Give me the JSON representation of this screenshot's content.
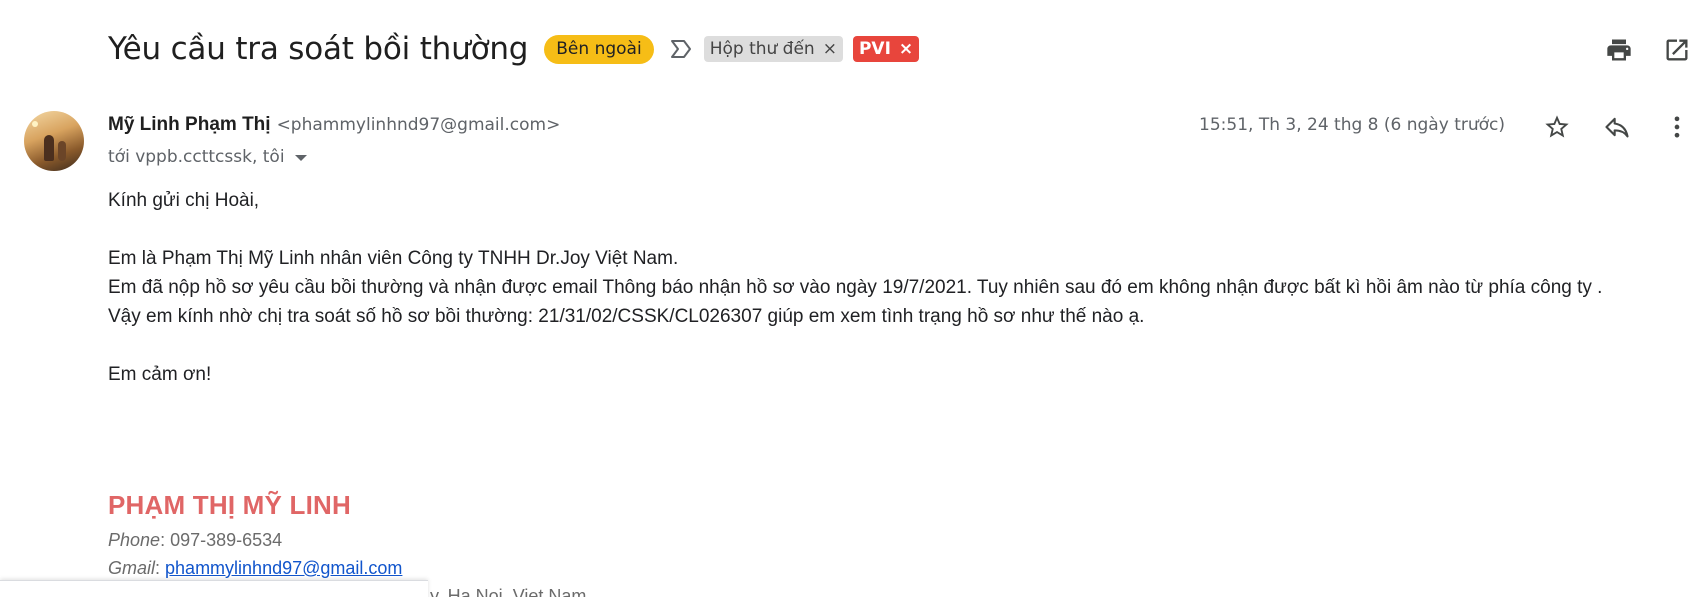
{
  "subject": "Yêu cầu tra soát bồi thường",
  "external_badge": "Bên ngoài",
  "labels": [
    {
      "name": "Hộp thư đến",
      "remove": "×"
    },
    {
      "name": "PVI",
      "remove": "×"
    }
  ],
  "colors": {
    "external_badge": "#f6bd16",
    "pvi_label": "#e8453c",
    "inbox_label": "#dddddd",
    "signature_name": "#e06666",
    "link": "#1155cc"
  },
  "icons": {
    "important": "important-marker-icon",
    "print": "print-icon",
    "new_window": "open-in-new-window-icon",
    "star": "star-icon",
    "reply": "reply-icon",
    "more": "more-vertical-icon"
  },
  "message": {
    "sender_name": "Mỹ Linh Phạm Thị",
    "sender_email": "<phammylinhnd97@gmail.com>",
    "recipients": "tới vppb.ccttcssk, tôi",
    "date": "15:51, Th 3, 24 thg 8 (6 ngày trước)",
    "body": [
      "Kính gửi chị Hoài,",
      "",
      "Em là Phạm Thị Mỹ Linh nhân viên Công ty TNHH Dr.Joy Việt Nam.",
      "Em đã nộp hồ sơ yêu cầu bồi thường và nhận được email Thông báo nhận hồ sơ vào ngày 19/7/2021. Tuy nhiên sau đó em không nhận được bất kì hồi âm nào từ phía công ty .",
      "Vậy em kính nhờ chị tra soát số hồ sơ bồi thường: 21/31/02/CSSK/CL026307 giúp em xem tình trạng hồ sơ như thế nào ạ.",
      "",
      "Em cảm ơn!"
    ]
  },
  "signature": {
    "name": "PHẠM THỊ MỸ LINH",
    "phone_label": "Phone",
    "phone_value": ": 097-389-6534",
    "gmail_label": "Gmail",
    "gmail_sep": ": ",
    "gmail_value": "phammylinhnd97@gmail.com",
    "address_partial": "y, Ha Noi, Viet Nam"
  }
}
